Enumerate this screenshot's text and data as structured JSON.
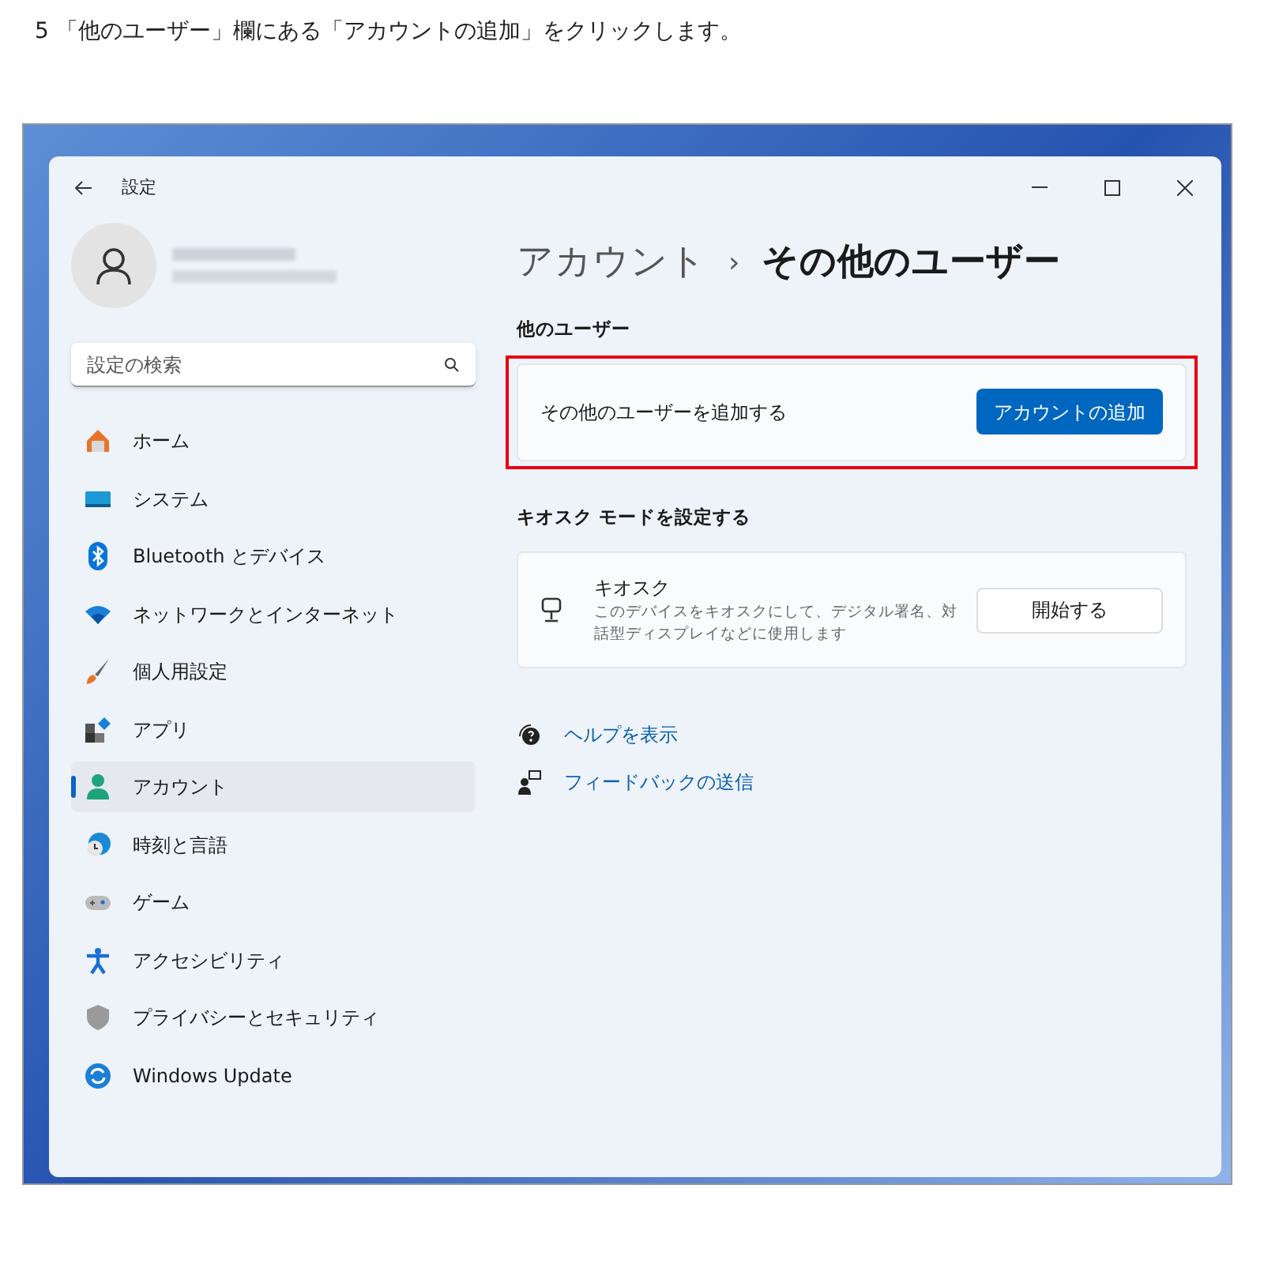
{
  "caption": "5 「他のユーザー」欄にある「アカウントの追加」をクリックします。",
  "window": {
    "title": "設定"
  },
  "search": {
    "placeholder": "設定の検索"
  },
  "sidebar": {
    "items": [
      {
        "label": "ホーム",
        "selected": false
      },
      {
        "label": "システム",
        "selected": false
      },
      {
        "label": "Bluetooth とデバイス",
        "selected": false
      },
      {
        "label": "ネットワークとインターネット",
        "selected": false
      },
      {
        "label": "個人用設定",
        "selected": false
      },
      {
        "label": "アプリ",
        "selected": false
      },
      {
        "label": "アカウント",
        "selected": true
      },
      {
        "label": "時刻と言語",
        "selected": false
      },
      {
        "label": "ゲーム",
        "selected": false
      },
      {
        "label": "アクセシビリティ",
        "selected": false
      },
      {
        "label": "プライバシーとセキュリティ",
        "selected": false
      },
      {
        "label": "Windows Update",
        "selected": false
      }
    ]
  },
  "breadcrumb": {
    "parent": "アカウント",
    "separator": "›",
    "current": "その他のユーザー"
  },
  "sections": [
    {
      "heading": "他のユーザー",
      "highlighted": true,
      "card": {
        "title": "その他のユーザーを追加する",
        "button": "アカウントの追加",
        "primary": true
      }
    },
    {
      "heading": "キオスク モードを設定する",
      "highlighted": false,
      "card": {
        "title": "キオスク",
        "description": "このデバイスをキオスクにして、デジタル署名、対話型ディスプレイなどに使用します",
        "button": "開始する",
        "primary": false
      }
    }
  ],
  "links": [
    "ヘルプを表示",
    "フィードバックの送信"
  ]
}
